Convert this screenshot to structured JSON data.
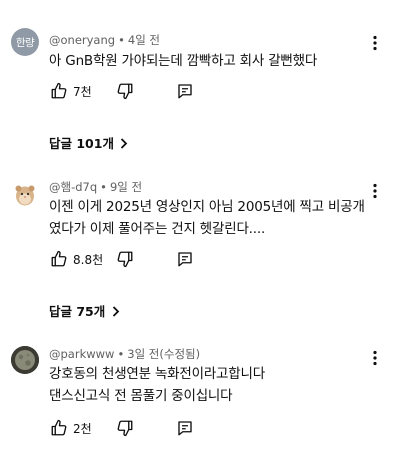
{
  "comments": [
    {
      "avatar_text": "한량",
      "author": "@oneryang",
      "time": "4일 전",
      "lines": [
        "아 GnB학원 가야되는데 깜빡하고 회사 갈뻔했다"
      ],
      "likes": "7천",
      "replies_label": "답글 101개"
    },
    {
      "author": "@햄-d7q",
      "time": "9일 전",
      "lines": [
        "이젠 이게 2025년 영상인지 아님 2005년에 찍고 비공개",
        "였다가 이제 풀어주는 건지 헷갈린다...."
      ],
      "likes": "8.8천",
      "replies_label": "답글 75개"
    },
    {
      "author": "@parkwww",
      "time": "3일 전(수정됨)",
      "lines": [
        "강호동의 천생연분 녹화전이라고합니다",
        "댄스신고식 전 몸풀기 중이십니다"
      ],
      "likes": "2천"
    }
  ],
  "icons": {
    "like": "thumbs-up-icon",
    "dislike": "thumbs-down-icon",
    "reply": "comment-reply-icon",
    "more": "more-vertical-icon",
    "chevron": "chevron-right-icon"
  },
  "colors": {
    "text": "#0f0f0f",
    "meta": "#606060",
    "avatar_1": "#8f9aa6",
    "avatar_3": "#3b3b34"
  }
}
